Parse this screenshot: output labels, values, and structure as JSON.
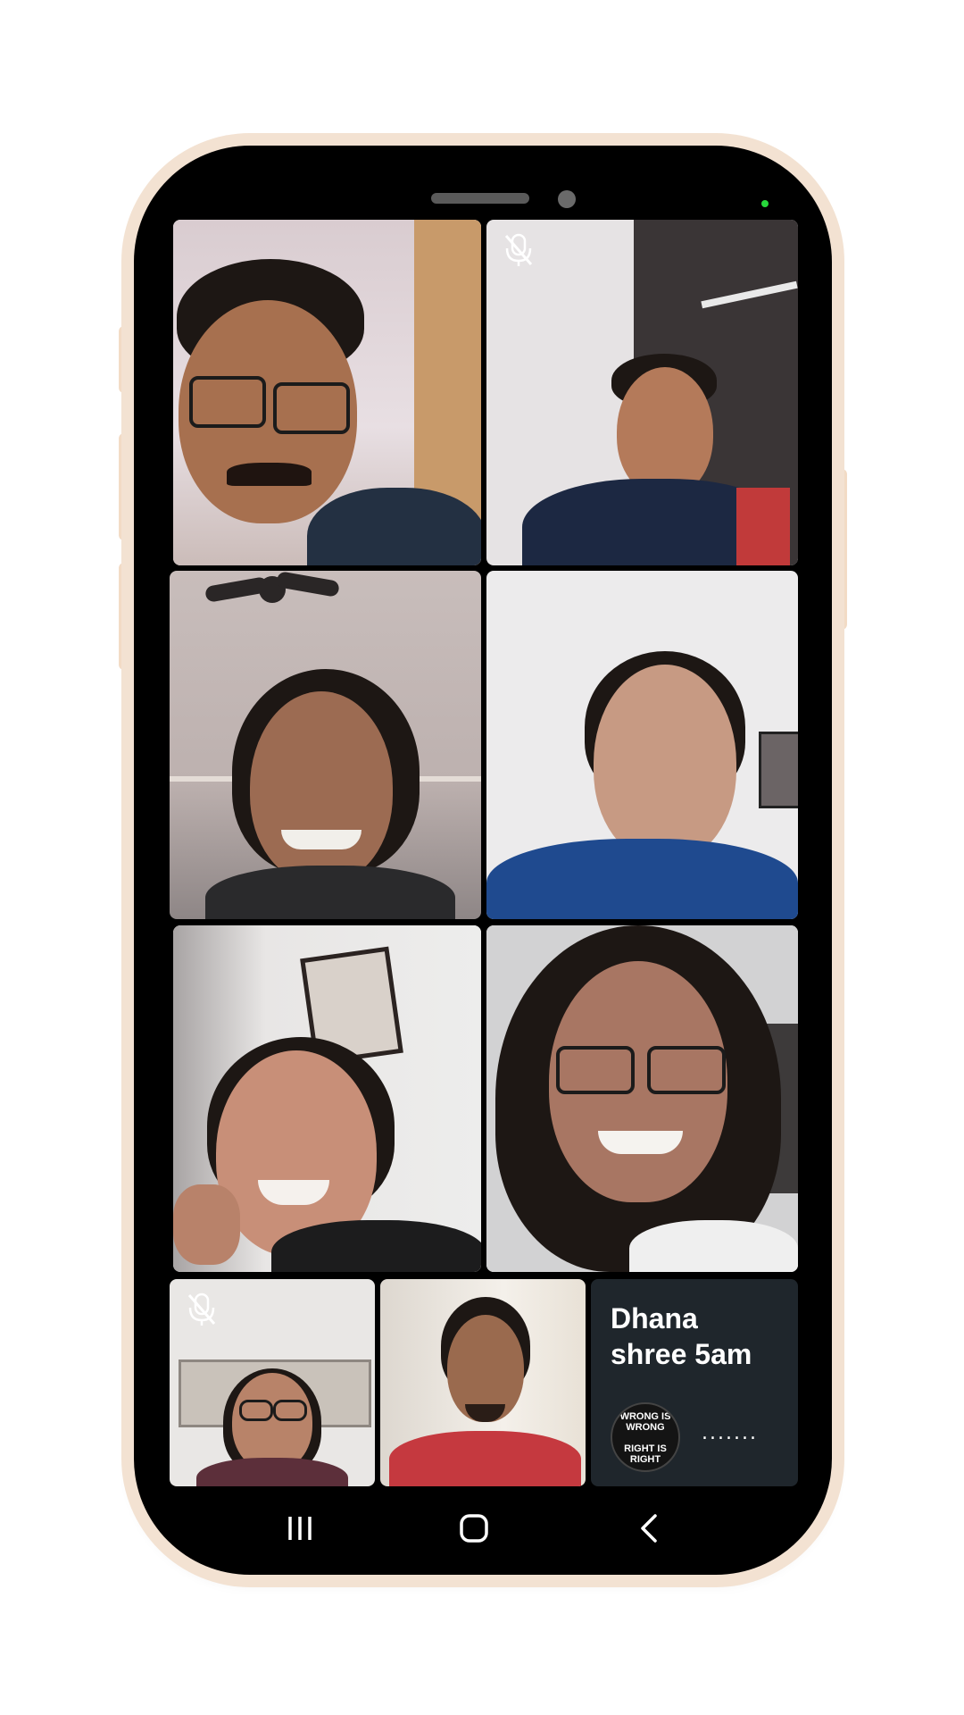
{
  "tiles": {
    "participant_9": {
      "name_line1": "Dhana",
      "name_line2": "shree 5am",
      "avatar_text_top": "WRONG IS WRONG",
      "avatar_text_bottom": "RIGHT IS RIGHT",
      "status": "......."
    }
  },
  "icons": {
    "mute": "mic-off-icon",
    "recents": "recents-icon",
    "home": "home-icon",
    "back": "back-icon"
  },
  "colors": {
    "name_tile_bg": "#1f262c",
    "phone_frame": "#000000",
    "frame_accent": "#f3dcc6",
    "indicator_led": "#27d83b"
  }
}
